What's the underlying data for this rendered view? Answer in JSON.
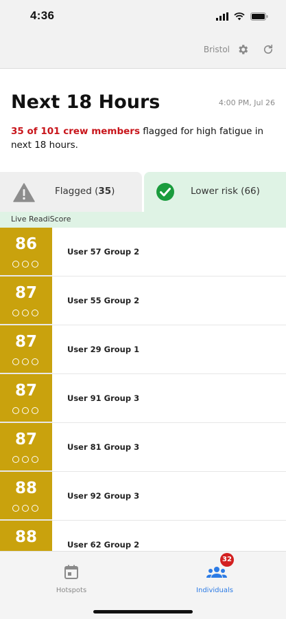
{
  "status_bar": {
    "time": "4:36"
  },
  "top_bar": {
    "location": "Bristol"
  },
  "summary": {
    "title": "Next 18 Hours",
    "timestamp": "4:00 PM, Jul 26",
    "flagged_text": "35 of 101 crew members",
    "rest_text": " flagged for high fatigue in next 18 hours."
  },
  "tabs": {
    "flagged": {
      "label": "Flagged (",
      "count": "35",
      "close": ")"
    },
    "lower": {
      "label": "Lower risk (66)"
    }
  },
  "live_label": "Live ReadiScore",
  "rows": [
    {
      "score": "86",
      "name": "User 57 Group 2"
    },
    {
      "score": "87",
      "name": "User 55 Group 2"
    },
    {
      "score": "87",
      "name": "User 29 Group 1"
    },
    {
      "score": "87",
      "name": "User 91 Group 3"
    },
    {
      "score": "87",
      "name": "User 81 Group 3"
    },
    {
      "score": "88",
      "name": "User 92 Group 3"
    },
    {
      "score": "88",
      "name": "User 62 Group 2"
    }
  ],
  "bottom_nav": {
    "hotspots": {
      "label": "Hotspots"
    },
    "individuals": {
      "label": "Individuals",
      "badge": "32"
    }
  },
  "colors": {
    "score_fill": "#c9a20d",
    "flag_red": "#c8151b",
    "lower_risk_green": "#dff3e5",
    "active_blue": "#2c7be5"
  }
}
